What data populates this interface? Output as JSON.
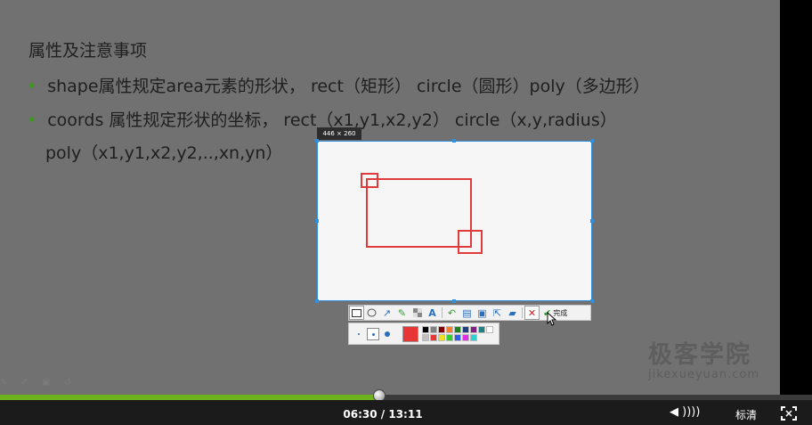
{
  "slide": {
    "title": "属性及注意事项",
    "bullets": [
      "shape属性规定area元素的形状，  rect（矩形） circle（圆形）poly（多边形）",
      "coords 属性规定形状的坐标，  rect（x1,y1,x2,y2）    circle（x,y,radius）"
    ],
    "bullet2_cont": "poly（x1,y1,x2,y2,..,xn,yn）",
    "bullet_mark": "•"
  },
  "watermark": {
    "cn": "极客学院",
    "en": "jikexueyuan.com"
  },
  "capture": {
    "size_label": "446 × 260",
    "toolbar": {
      "tools": [
        "rectangle-icon",
        "ellipse-icon",
        "arrow-icon",
        "pen-icon",
        "mosaic-icon",
        "text-icon",
        "undo-icon",
        "save-icon",
        "copy-icon",
        "share-icon",
        "pin-icon",
        "cancel-icon"
      ],
      "done_label": "完成"
    },
    "palette": {
      "current_color": "#e83535",
      "colors": [
        "#000000",
        "#808080",
        "#800000",
        "#f08030",
        "#208020",
        "#204080",
        "#802080",
        "#208080",
        "#ffffff",
        "#c0c0c0",
        "#e83535",
        "#f0e020",
        "#30d030",
        "#3060e0",
        "#e030e0",
        "#30d0d0"
      ]
    }
  },
  "player": {
    "time": "06:30 / 13:11",
    "progress_percent": 47.2,
    "quality": "标清"
  }
}
